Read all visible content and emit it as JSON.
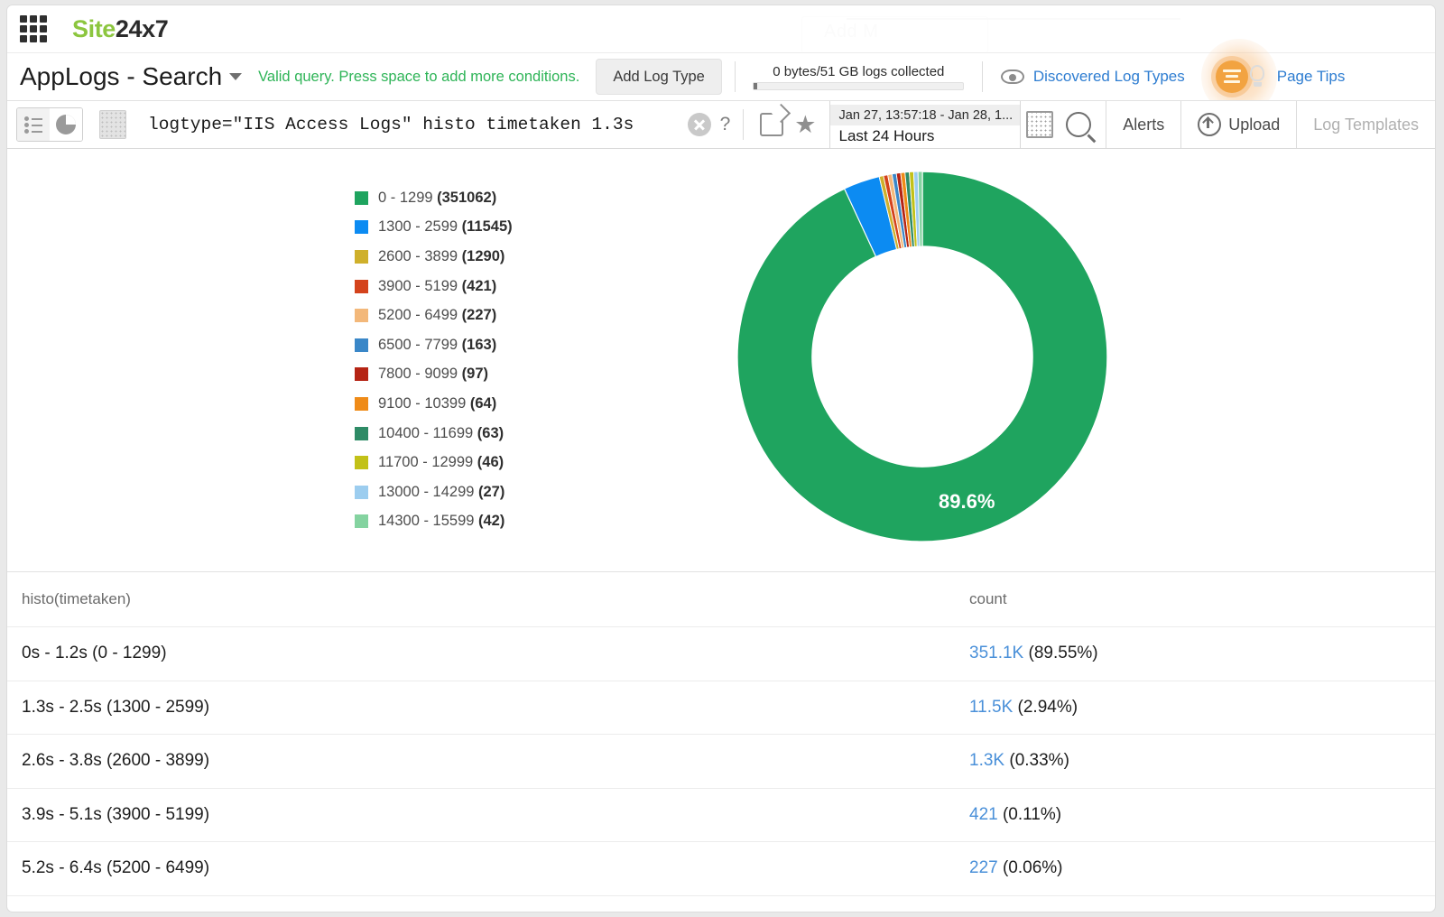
{
  "brand": {
    "logo_green": "Site",
    "logo_dark": "24x7",
    "apps_icon": "apps-grid-icon",
    "ghost_text": "Add M"
  },
  "header": {
    "page_title": "AppLogs - Search",
    "title_caret": "chevron-down-icon",
    "valid_message": "Valid query. Press space to add more conditions.",
    "add_log_type_button": "Add Log Type",
    "collected_label": "0 bytes/51 GB logs collected",
    "collected_progress_pct": 1,
    "eye_icon": "eye-icon",
    "discovered_log_types": "Discovered Log Types",
    "page_tips": "Page Tips",
    "tips_icon": "page-tips-icon",
    "bulb_icon": "lightbulb-icon",
    "link_color": "#2e7dd1",
    "valid_color": "#2eb457"
  },
  "toolbar": {
    "view_list_icon": "list-view-icon",
    "view_pie_icon": "pie-view-icon",
    "log_doc_icon": "log-document-icon",
    "query": "logtype=\"IIS Access Logs\" histo timetaken 1.3s",
    "clear_icon": "clear-query-icon",
    "help_icon": "?",
    "share_icon": "share-icon",
    "favorite_icon": "star-icon",
    "date_range_top": "Jan 27, 13:57:18 - Jan 28, 1...",
    "date_range_bottom": "Last 24 Hours",
    "calendar_icon": "calendar-icon",
    "search_icon": "search-icon",
    "alerts": "Alerts",
    "upload": "Upload",
    "upload_icon": "upload-icon",
    "log_templates": "Log Templates"
  },
  "chart_data": {
    "type": "pie",
    "title": "",
    "variant": "donut",
    "center_label": "",
    "highlight_label": "89.6%",
    "legend_position": "left",
    "categories": [
      "0 - 1299",
      "1300 - 2599",
      "2600 - 3899",
      "3900 - 5199",
      "5200 - 6499",
      "6500 - 7799",
      "7800 - 9099",
      "9100 - 10399",
      "10400 - 11699",
      "11700 - 12999",
      "13000 - 14299",
      "14300 - 15599"
    ],
    "values": [
      351062,
      11545,
      1290,
      421,
      227,
      163,
      97,
      64,
      63,
      46,
      27,
      42
    ],
    "legend_labels": [
      "0 - 1299 (351062)",
      "1300 - 2599 (11545)",
      "2600 - 3899 (1290)",
      "3900 - 5199 (421)",
      "5200 - 6499 (227)",
      "6500 - 7799 (163)",
      "7800 - 9099 (97)",
      "9100 - 10399 (64)",
      "10400 - 11699 (63)",
      "11700 - 12999 (46)",
      "13000 - 14299 (27)",
      "14300 - 15599 (42)"
    ],
    "colors": [
      "#1fa45f",
      "#0c8bf2",
      "#cfb02b",
      "#d4431c",
      "#f3b87a",
      "#3a87c8",
      "#b52414",
      "#ef8b18",
      "#2e8b66",
      "#c2c118",
      "#9ccdef",
      "#84d3a0"
    ]
  },
  "results_table": {
    "columns": [
      "histo(timetaken)",
      "count"
    ],
    "rows": [
      {
        "bucket": "0s - 1.2s (0 - 1299)",
        "count": "351.1K",
        "pct": "(89.55%)"
      },
      {
        "bucket": "1.3s - 2.5s (1300 - 2599)",
        "count": "11.5K",
        "pct": "(2.94%)"
      },
      {
        "bucket": "2.6s - 3.8s (2600 - 3899)",
        "count": "1.3K",
        "pct": "(0.33%)"
      },
      {
        "bucket": "3.9s - 5.1s (3900 - 5199)",
        "count": "421",
        "pct": "(0.11%)"
      },
      {
        "bucket": "5.2s - 6.4s (5200 - 6499)",
        "count": "227",
        "pct": "(0.06%)"
      }
    ]
  }
}
